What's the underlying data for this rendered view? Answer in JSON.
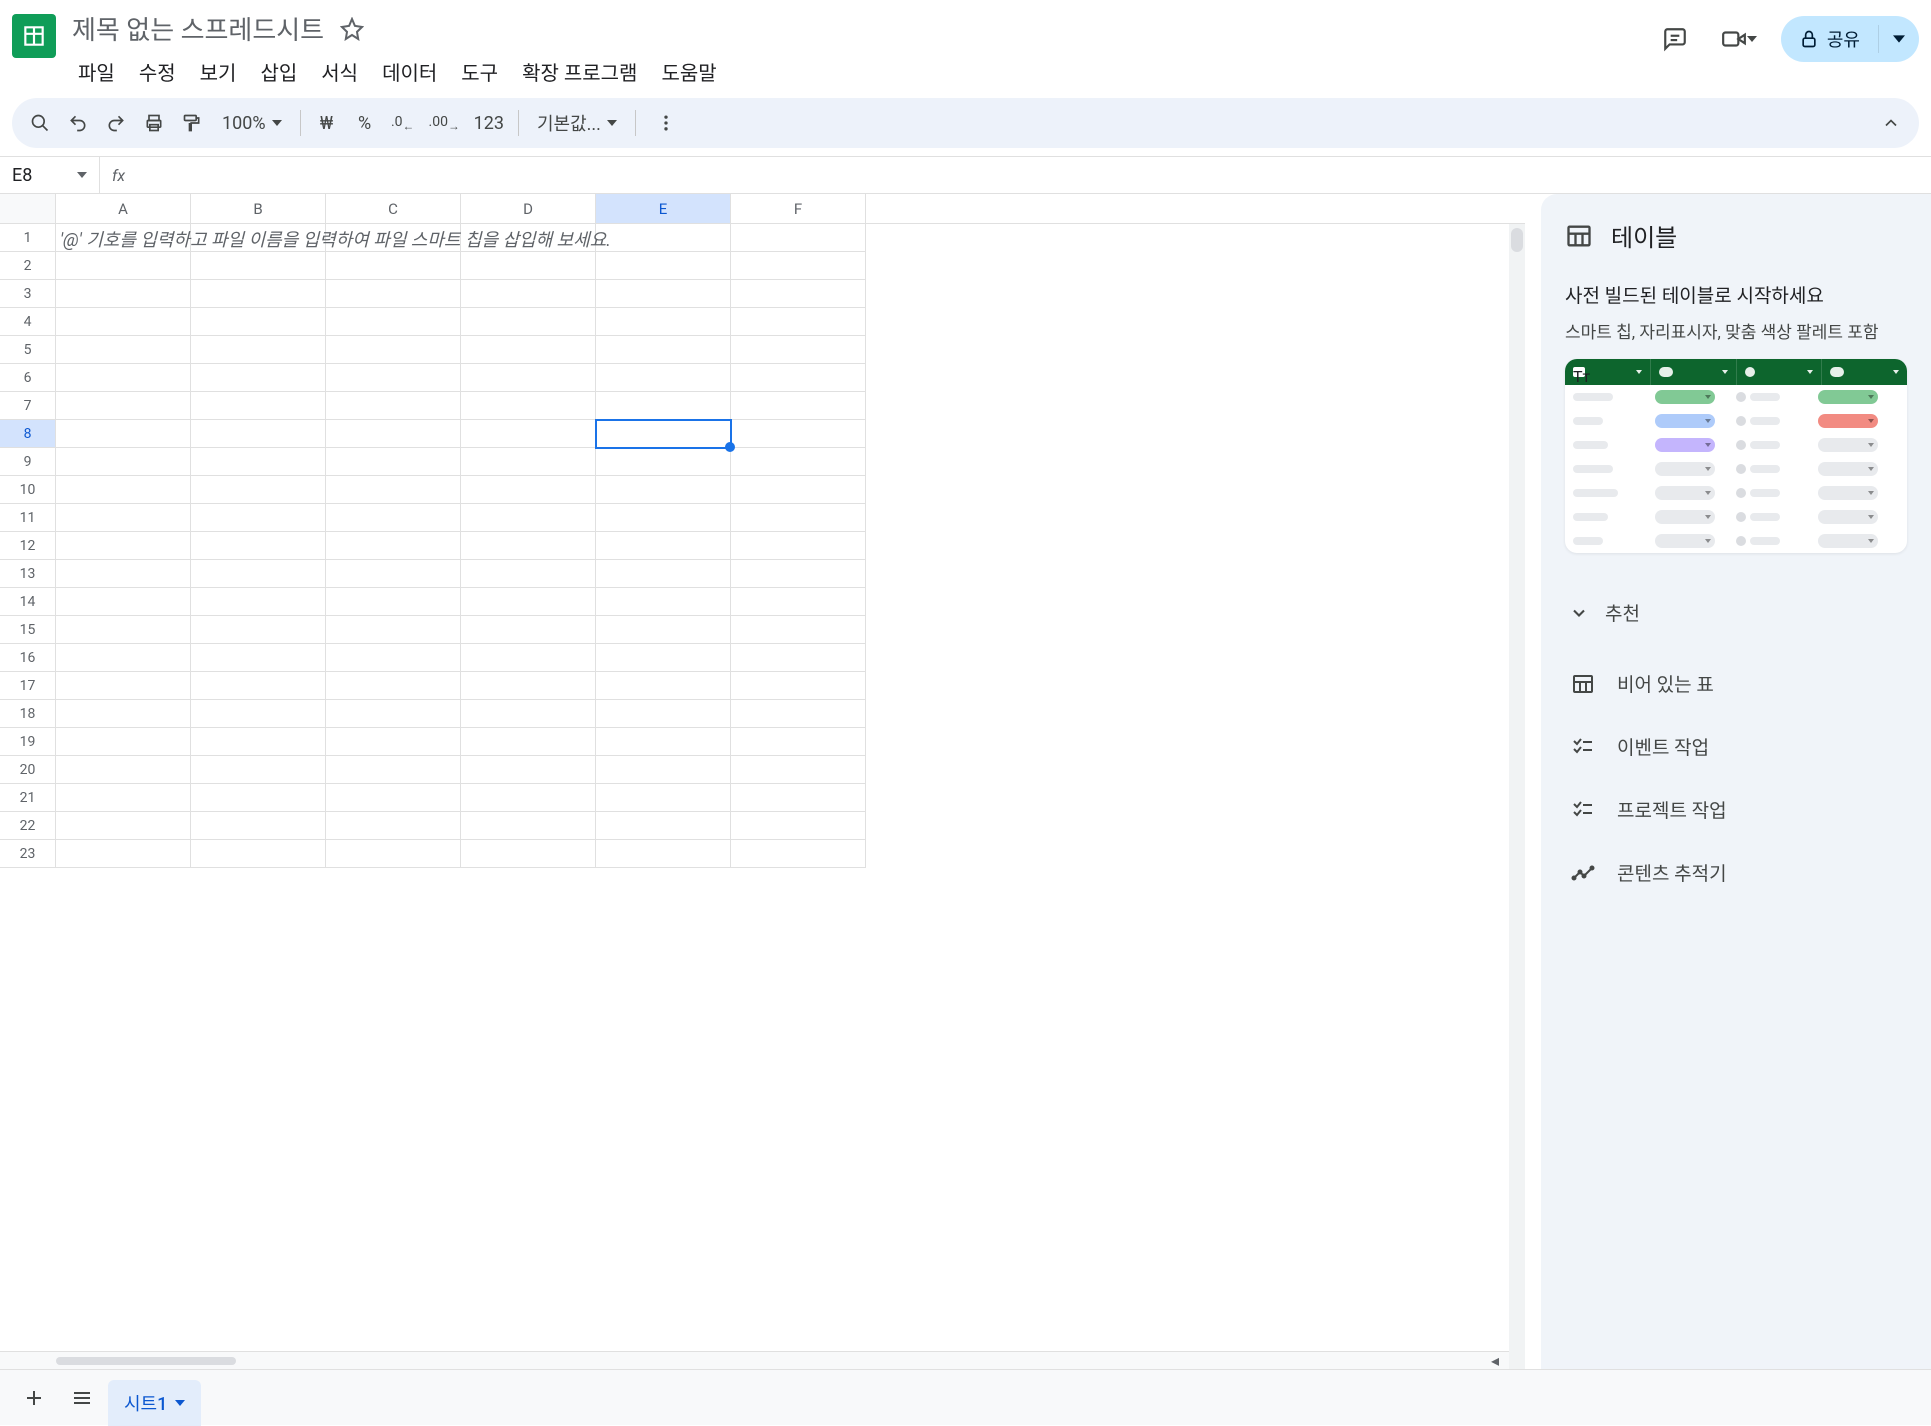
{
  "header": {
    "title": "제목 없는 스프레드시트",
    "menus": [
      "파일",
      "수정",
      "보기",
      "삽입",
      "서식",
      "데이터",
      "도구",
      "확장 프로그램",
      "도움말"
    ],
    "share_label": "공유"
  },
  "toolbar": {
    "zoom": "100%",
    "font": "기본값...",
    "currency_symbol": "₩",
    "percent_symbol": "%",
    "dec_decrease": ".0",
    "dec_increase": ".00",
    "format_123": "123"
  },
  "formula_bar": {
    "cell_ref": "E8",
    "fx": "fx",
    "value": ""
  },
  "grid": {
    "columns": [
      "A",
      "B",
      "C",
      "D",
      "E",
      "F"
    ],
    "row_count": 23,
    "active_col_index": 4,
    "active_row": 8,
    "hint_cell_text": "'@' 기호를 입력하고 파일 이름을 입력하여 파일 스마트 칩을 삽입해 보세요."
  },
  "side_panel": {
    "title": "테이블",
    "subtitle1": "사전 빌드된 테이블로 시작하세요",
    "subtitle2": "스마트 칩, 자리표시자, 맞춤 색상 팔레트 포함",
    "section_recommended": "추천",
    "options": [
      {
        "icon": "table",
        "label": "비어 있는 표"
      },
      {
        "icon": "tasks",
        "label": "이벤트 작업"
      },
      {
        "icon": "tasks",
        "label": "프로젝트 작업"
      },
      {
        "icon": "trend",
        "label": "콘텐츠 추적기"
      }
    ]
  },
  "sheet_tabs": {
    "active": "시트1"
  }
}
